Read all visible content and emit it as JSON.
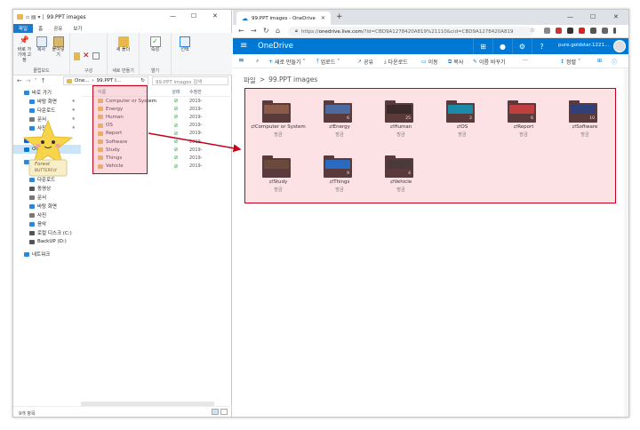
{
  "explorer": {
    "title": "99.PPT images",
    "ribbon_tabs": [
      "파일",
      "홈",
      "공유",
      "보기"
    ],
    "ribbon_groups": [
      {
        "label": "클립보드",
        "buttons": [
          "바로 가기에 고정",
          "복사",
          "붙여넣기"
        ]
      },
      {
        "label": "구성",
        "buttons": []
      },
      {
        "label": "새로 만들기",
        "buttons": [
          "새 폴더"
        ]
      },
      {
        "label": "열기",
        "buttons": [
          "속성"
        ]
      },
      {
        "label": "",
        "buttons": [
          "선택"
        ]
      }
    ],
    "address_path": "99.PPT I...",
    "address_prefix": "One...",
    "search_placeholder": "99.PPT images 검색",
    "nav": [
      {
        "label": "바로 가기",
        "icon": "star-icon",
        "color": "#2b88d8"
      },
      {
        "label": "바탕 화면",
        "icon": "desktop-icon",
        "color": "#2b88d8"
      },
      {
        "label": "다운로드",
        "icon": "download-icon",
        "color": "#2b88d8"
      },
      {
        "label": "문서",
        "icon": "document-icon",
        "color": "#777777"
      },
      {
        "label": "사진",
        "icon": "picture-icon",
        "color": "#2b88d8"
      },
      {
        "label": "Dropbox",
        "icon": "dropbox-icon",
        "color": "#0061fe"
      },
      {
        "label": "OneDrive",
        "icon": "onedrive-icon",
        "color": "#0078d4",
        "selected": true
      },
      {
        "label": "내 PC",
        "icon": "pc-icon",
        "color": "#2b88d8"
      },
      {
        "label": "3D 개체",
        "icon": "cube-icon",
        "color": "#3aa0e0"
      },
      {
        "label": "다운로드",
        "icon": "download-icon",
        "color": "#2b88d8"
      },
      {
        "label": "동영상",
        "icon": "video-icon",
        "color": "#555555"
      },
      {
        "label": "문서",
        "icon": "document-icon",
        "color": "#777777"
      },
      {
        "label": "바탕 화면",
        "icon": "desktop-icon",
        "color": "#2b88d8"
      },
      {
        "label": "사진",
        "icon": "picture-icon",
        "color": "#777777"
      },
      {
        "label": "음악",
        "icon": "music-icon",
        "color": "#2b88d8"
      },
      {
        "label": "로컬 디스크 (C:)",
        "icon": "drive-icon",
        "color": "#555555"
      },
      {
        "label": "BackUP (D:)",
        "icon": "drive-icon",
        "color": "#555555"
      },
      {
        "label": "네트워크",
        "icon": "network-icon",
        "color": "#2b88d8"
      }
    ],
    "columns": {
      "name": "이름",
      "status": "상태",
      "date": "수정한"
    },
    "folders": [
      {
        "name": "Computer or System",
        "date": "2019-"
      },
      {
        "name": "Energy",
        "date": "2019-"
      },
      {
        "name": "Human",
        "date": "2019-"
      },
      {
        "name": "OS",
        "date": "2019-"
      },
      {
        "name": "Report",
        "date": "2019-"
      },
      {
        "name": "Software",
        "date": "2019-"
      },
      {
        "name": "Study",
        "date": "2019-"
      },
      {
        "name": "Things",
        "date": "2019-"
      },
      {
        "name": "Vehicle",
        "date": "2019-"
      }
    ],
    "status_bar": "9개 항목",
    "sticker": {
      "line1": "Forest",
      "line2": "BUTTERFLY"
    }
  },
  "browser": {
    "tab_title": "99.PPT images - OneDrive",
    "url_prefix": "https://",
    "url_host": "onedrive.live.com",
    "url_rest": "/?id=CBD9A1278420A819%21110&cid=CBD9A1278420A819",
    "onedrive_brand": "OneDrive",
    "user": "pure.goldstar.1221...",
    "commands": [
      "새로 만들기",
      "업로드",
      "공유",
      "다운로드",
      "이동",
      "복사",
      "이름 바꾸기",
      "···"
    ],
    "sort_label": "정렬",
    "breadcrumb_root": "파일",
    "breadcrumb_sep": ">",
    "breadcrumb_current": "99.PPT images",
    "tiles": [
      {
        "name": "Computer or System",
        "count": "",
        "shared": "방금",
        "img": "#8a5a4a"
      },
      {
        "name": "Energy",
        "count": "6",
        "shared": "방금",
        "img": "#4a6aa0"
      },
      {
        "name": "Human",
        "count": "25",
        "shared": "방금",
        "img": "#3a2a2a"
      },
      {
        "name": "OS",
        "count": "2",
        "shared": "방금",
        "img": "#1a8aa8"
      },
      {
        "name": "Report",
        "count": "6",
        "shared": "방금",
        "img": "#c04040"
      },
      {
        "name": "Software",
        "count": "10",
        "shared": "방금",
        "img": "#30407a"
      },
      {
        "name": "Study",
        "count": "",
        "shared": "방금",
        "img": "#6a4a3a"
      },
      {
        "name": "Things",
        "count": "9",
        "shared": "방금",
        "img": "#2a6ac0"
      },
      {
        "name": "Vehicle",
        "count": "4",
        "shared": "방금",
        "img": "#4a3a3a"
      }
    ]
  },
  "colors": {
    "accent": "#0078d4",
    "highlight_border": "#c4001a",
    "folder": "#e8b84a",
    "sync_ok": "#27a54a"
  }
}
